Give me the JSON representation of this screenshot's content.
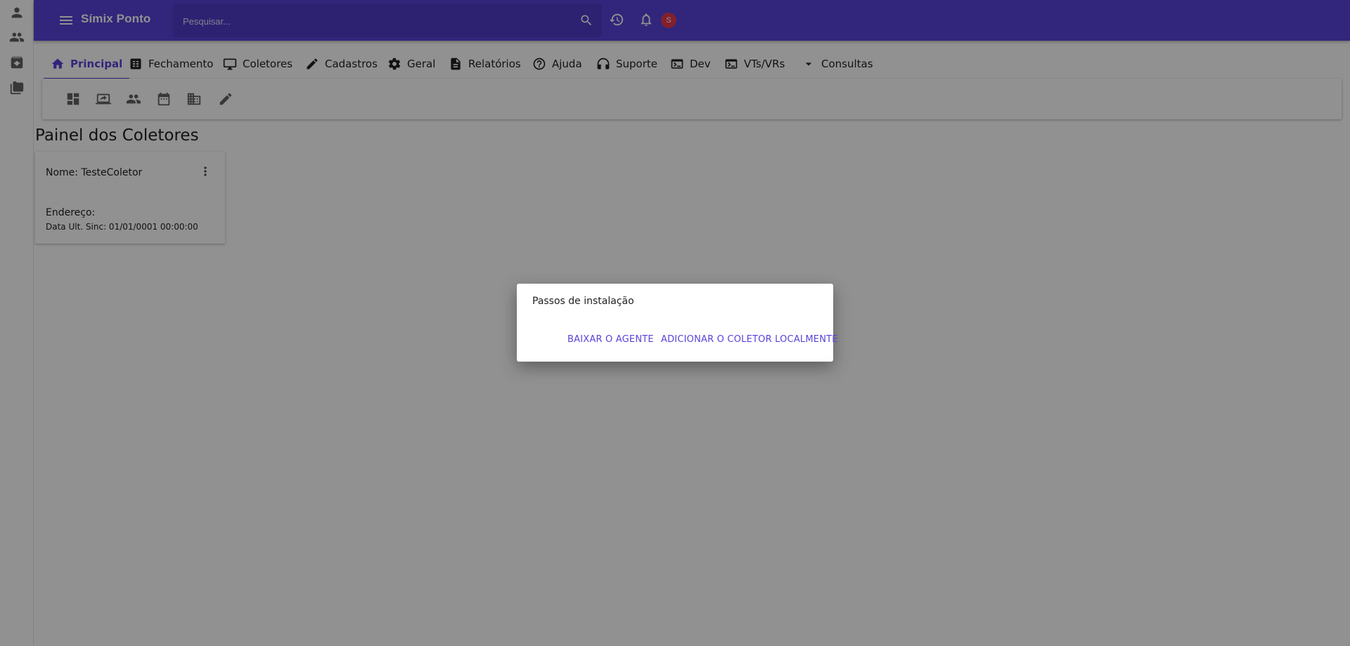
{
  "rail": {
    "icons": [
      "person-icon",
      "people-icon",
      "archive-icon",
      "folders-icon"
    ]
  },
  "topbar": {
    "app_title": "Símix Ponto",
    "search_placeholder": "Pesquisar...",
    "avatar_letter": "S",
    "brand_color": "#5743d9"
  },
  "tabs": [
    {
      "label": "Principal",
      "icon": "home-icon",
      "active": true
    },
    {
      "label": "Fechamento",
      "icon": "table-icon"
    },
    {
      "label": "Coletores",
      "icon": "monitor-icon"
    },
    {
      "label": "Cadastros",
      "icon": "pencil-icon"
    },
    {
      "label": "Geral",
      "icon": "gear-icon"
    },
    {
      "label": "Relatórios",
      "icon": "document-icon"
    },
    {
      "label": "Ajuda",
      "icon": "help-icon"
    },
    {
      "label": "Suporte",
      "icon": "support-icon"
    },
    {
      "label": "Dev",
      "icon": "terminal-icon"
    },
    {
      "label": "VTs/VRs",
      "icon": "terminal-icon"
    },
    {
      "label": "Consultas",
      "icon": "caret-down-icon"
    }
  ],
  "toolbar": {
    "icons": [
      "dashboard-icon",
      "screen-share-icon",
      "people-icon",
      "calendar-icon",
      "building-icon",
      "pencil-icon"
    ]
  },
  "main": {
    "title": "Painel dos Coletores",
    "card": {
      "name": "Nome: TesteColetor",
      "address": "Endereço:",
      "last_sync": "Data Ult. Sinc: 01/01/0001 00:00:00"
    }
  },
  "dialog": {
    "title": "Passos de instalação",
    "download_label": "BAIXAR O AGENTE",
    "add_local_label": "ADICIONAR O COLETOR LOCALMENTE"
  }
}
